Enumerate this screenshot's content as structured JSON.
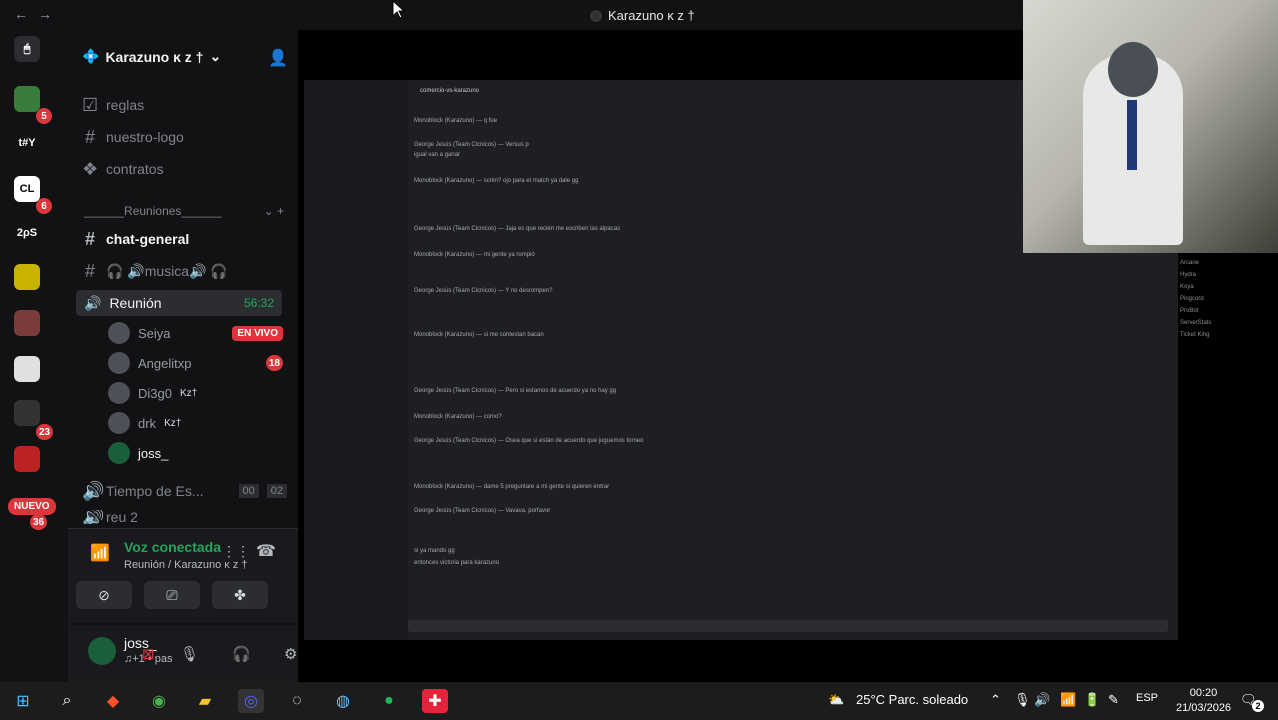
{
  "titlebar": {
    "back": "←",
    "forward": "→",
    "title": "Karazuno ĸ z †"
  },
  "servers": {
    "badges": [
      "5",
      "6",
      "23",
      "36"
    ],
    "labels": [
      "t#Y",
      "CL",
      "2ρS"
    ],
    "nuevo": "NUEVO"
  },
  "sidebar": {
    "server_name": "Karazuno ĸ z †",
    "channels": [
      {
        "label": "reglas"
      },
      {
        "label": "nuestro-logo"
      },
      {
        "label": "contratos"
      }
    ],
    "category": "______Reuniones______",
    "text_channels": [
      {
        "label": "chat-general"
      },
      {
        "label": "🎧 🔊musica🔊 🎧"
      }
    ],
    "voice_channel": {
      "label": "Reunión",
      "time": "56:32"
    },
    "members": [
      {
        "name": "Seiya",
        "live": "EN VIVO"
      },
      {
        "name": "Angelitxp",
        "count": "18"
      },
      {
        "name": "Di3g0",
        "tag": "Kz†"
      },
      {
        "name": "drk",
        "tag": "Kz†"
      },
      {
        "name": "joss_"
      }
    ],
    "tiempo": {
      "label": "Tiempo de Es...",
      "a": "00",
      "b": "02"
    },
    "reu2": "reu 2",
    "connection": {
      "label": "Voz conectada",
      "sub": "Reunión / Karazuno ĸ z †"
    },
    "user": {
      "name": "joss_",
      "status": "♫+1 • pas"
    }
  },
  "stream": {
    "inner_title": "comercio-vs-karazuno",
    "messages": [
      "Monoblock (Karazuno) — q fue",
      "George Jesús (Team Cicnicos) — Versus p",
      "igual van a ganar",
      "Monoblock (Karazuno) — scrim? ojo para el match ya dale gg",
      "George Jesús (Team Cicnicos) — Jaja es que recién me escriben las alpacas",
      "Monoblock (Karazuno) — mi gente ya rompió",
      "George Jesús (Team Cicnicos) — Y no desrompen?",
      "Monoblock (Karazuno) — si me contestan bacan",
      "George Jesús (Team Cicnicos) — Pero si estamos de acuerdo ya no hay gg",
      "Monoblock (Karazuno) — como?",
      "George Jesús (Team Cicnicos) — Osea que si están de acuerdo que juguemos torneo",
      "Monoblock (Karazuno) — dame 5 preguntare a mi gente si quieren entrar",
      "George Jesús (Team Cicnicos) — Vavava, porfavor",
      "si ya mando gg",
      "entonces victoria para karazuno"
    ],
    "members_list": [
      "Arcane",
      "Hydra",
      "Koya",
      "Pingcord",
      "ProBot",
      "ServerStats",
      "Ticket King"
    ]
  },
  "taskbar": {
    "weather": "25°C  Parc. soleado",
    "lang": "ESP",
    "time": "00:20",
    "date": "21/03/2026",
    "notif": "2"
  }
}
